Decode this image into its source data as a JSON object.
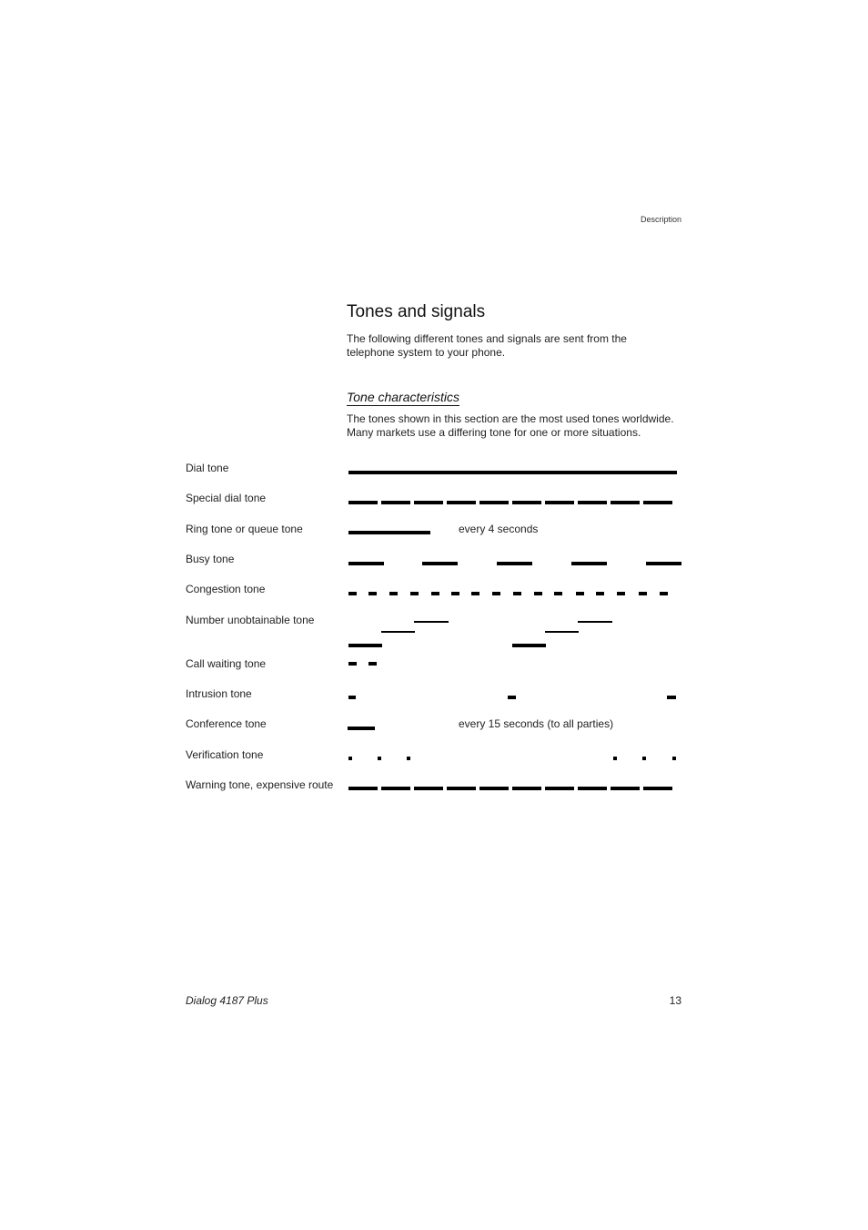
{
  "header": {
    "running_head": "Description"
  },
  "section": {
    "title": "Tones and signals",
    "intro": "The following different tones and signals are sent from the telephone system to your phone.",
    "subheading": "Tone characteristics",
    "subintro": "The tones shown in this section are the most used tones worldwide. Many markets use a differing tone for one or more situations."
  },
  "tones": [
    {
      "label": "Dial tone",
      "pattern": "continuous"
    },
    {
      "label": "Special dial tone",
      "pattern": "long dashes, short gaps (10 shown)"
    },
    {
      "label": "Ring tone or queue tone",
      "pattern": "single long burst",
      "note": "every 4 seconds"
    },
    {
      "label": "Busy tone",
      "pattern": "equal on/off (5 shown)"
    },
    {
      "label": "Congestion tone",
      "pattern": "short on/off (16 shown)"
    },
    {
      "label": "Number unobtainable tone",
      "pattern": "three rising steps, repeated twice"
    },
    {
      "label": "Call waiting tone",
      "pattern": "two short beeps"
    },
    {
      "label": "Intrusion tone",
      "pattern": "short beep, periodic (3 shown)"
    },
    {
      "label": "Conference tone",
      "pattern": "single burst",
      "note": "every 15 seconds (to all parties)"
    },
    {
      "label": "Verification tone",
      "pattern": "three very short beeps, repeated"
    },
    {
      "label": "Warning tone, expensive route",
      "pattern": "long dashes, short gaps (10 shown)"
    }
  ],
  "footer": {
    "product": "Dialog 4187 Plus",
    "page_number": "13"
  }
}
